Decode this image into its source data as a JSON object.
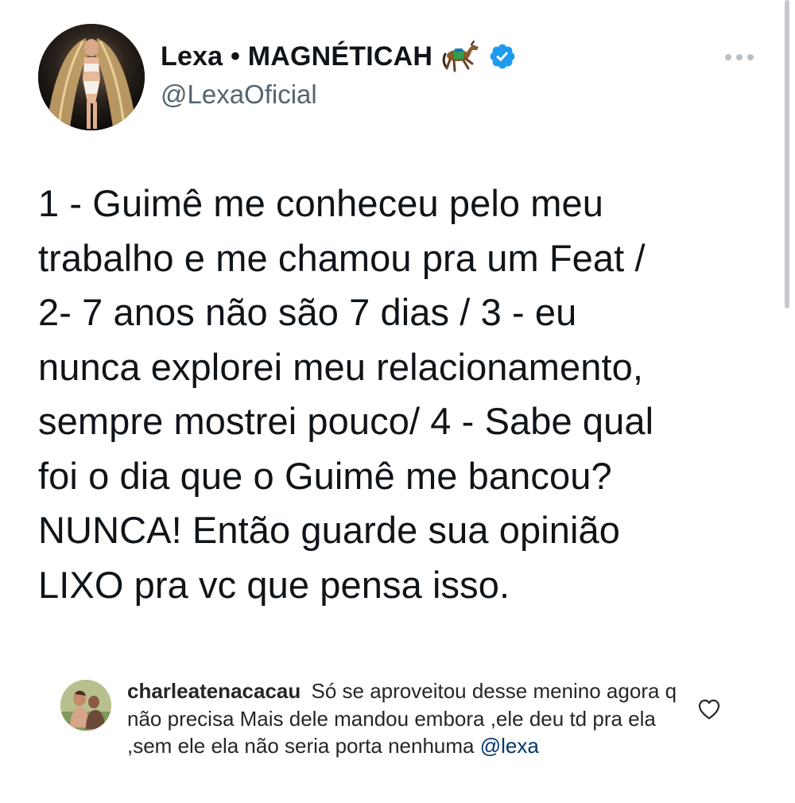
{
  "tweet": {
    "display_name": "Lexa • MAGNÉTICAH",
    "handle": "@LexaOficial",
    "badge_icon": "horse-emoji-icon",
    "verified_icon": "verified-badge-icon",
    "verified_color": "#1d9bf0",
    "text": "1 - Guimê me conheceu pelo meu\ntrabalho e me chamou pra um Feat /\n2- 7 anos não são 7 dias / 3 - eu\nnunca explorei meu relacionamento,\nsempre mostrei pouco/ 4 - Sabe qual\nfoi o dia que o Guimê me bancou?\nNUNCA! Então guarde sua opinião\nLIXO pra vc que pensa isso."
  },
  "comment": {
    "username": "charleatenacacau",
    "text": "Só se aproveitou desse menino agora q não precisa Mais dele mandou embora ,ele deu td pra ela ,sem ele ela não seria porta nenhuma",
    "mention": "@lexa",
    "like_icon": "heart-outline-icon"
  }
}
